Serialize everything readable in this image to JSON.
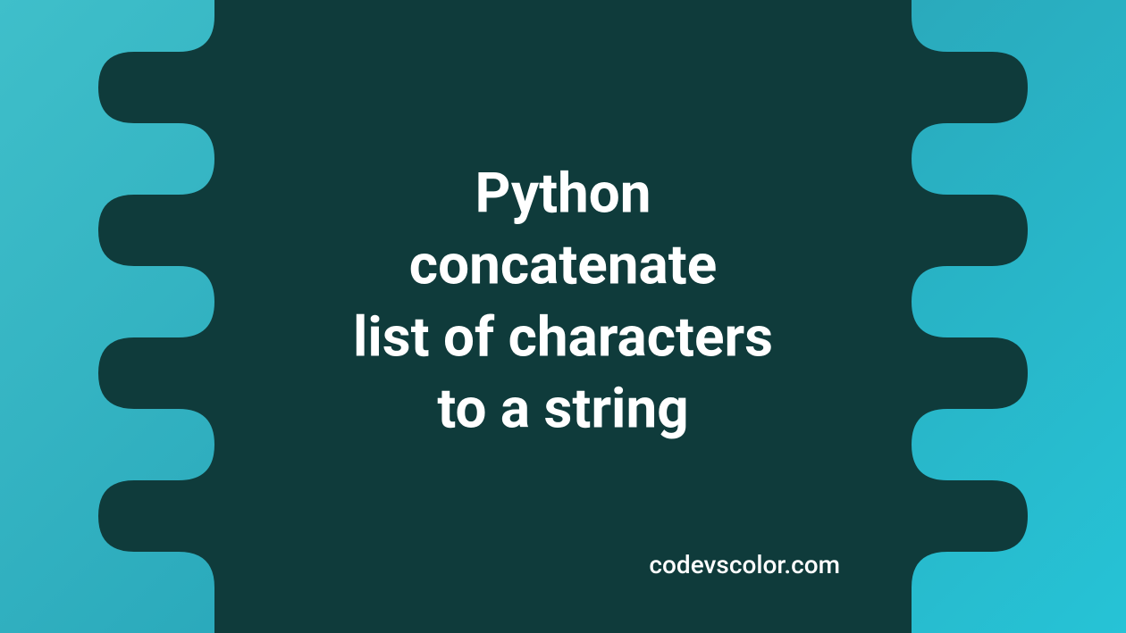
{
  "title_lines": "Python\nconcatenate\nlist of characters\nto a string",
  "credit": "codevscolor.com",
  "colors": {
    "blob": "#0f3b3b",
    "bg_start": "#3fbfca",
    "bg_end": "#26c3d6",
    "text": "#ffffff"
  }
}
